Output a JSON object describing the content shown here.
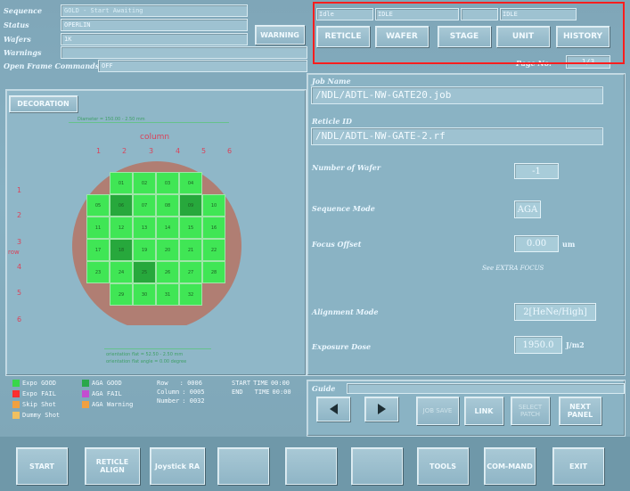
{
  "top_info": {
    "fields": [
      {
        "label": "Sequence",
        "value": "GOLD - Start Awaiting"
      },
      {
        "label": "Status",
        "value": "OPERLIN"
      },
      {
        "label": "Wafers",
        "value": "1K"
      },
      {
        "label": "Warnings",
        "value": ""
      },
      {
        "label": "Open Frame Commands",
        "value": "OFF"
      }
    ],
    "warning_button": "WARNING"
  },
  "top_right": {
    "small_labels": [
      "Idle",
      "IDLE",
      "IDLE"
    ],
    "buttons": [
      "RETICLE",
      "WAFER",
      "STAGE",
      "UNIT",
      "HISTORY"
    ],
    "page_no_label": "Page No.",
    "page_no_value": "1/3"
  },
  "wafer_panel": {
    "decoration_button": "DECORATION",
    "diameter_text": "Diameter = 150.00 - 2.50 mm",
    "column_title": "column",
    "column_labels": [
      "1",
      "2",
      "3",
      "4",
      "5",
      "6"
    ],
    "row_labels": [
      "1",
      "2",
      "3",
      "4",
      "5",
      "6"
    ],
    "row_title": "row",
    "orientation_text_1": "orientation flat = 52.50 - 2.50 mm",
    "orientation_text_2": "orientation flat angle = 0.00 degree",
    "shots": [
      {
        "r": 0,
        "c": 1,
        "shade": "light",
        "id": "01"
      },
      {
        "r": 0,
        "c": 2,
        "shade": "light",
        "id": "02"
      },
      {
        "r": 0,
        "c": 3,
        "shade": "light",
        "id": "03"
      },
      {
        "r": 0,
        "c": 4,
        "shade": "light",
        "id": "04"
      },
      {
        "r": 1,
        "c": 0,
        "shade": "light",
        "id": "05"
      },
      {
        "r": 1,
        "c": 1,
        "shade": "dark",
        "id": "06"
      },
      {
        "r": 1,
        "c": 2,
        "shade": "light",
        "id": "07"
      },
      {
        "r": 1,
        "c": 3,
        "shade": "light",
        "id": "08"
      },
      {
        "r": 1,
        "c": 4,
        "shade": "dark",
        "id": "09"
      },
      {
        "r": 1,
        "c": 5,
        "shade": "light",
        "id": "10"
      },
      {
        "r": 2,
        "c": 0,
        "shade": "light",
        "id": "11"
      },
      {
        "r": 2,
        "c": 1,
        "shade": "light",
        "id": "12"
      },
      {
        "r": 2,
        "c": 2,
        "shade": "light",
        "id": "13"
      },
      {
        "r": 2,
        "c": 3,
        "shade": "light",
        "id": "14"
      },
      {
        "r": 2,
        "c": 4,
        "shade": "light",
        "id": "15"
      },
      {
        "r": 2,
        "c": 5,
        "shade": "light",
        "id": "16"
      },
      {
        "r": 3,
        "c": 0,
        "shade": "light",
        "id": "17"
      },
      {
        "r": 3,
        "c": 1,
        "shade": "dark",
        "id": "18"
      },
      {
        "r": 3,
        "c": 2,
        "shade": "light",
        "id": "19"
      },
      {
        "r": 3,
        "c": 3,
        "shade": "light",
        "id": "20"
      },
      {
        "r": 3,
        "c": 4,
        "shade": "light",
        "id": "21"
      },
      {
        "r": 3,
        "c": 5,
        "shade": "light",
        "id": "22"
      },
      {
        "r": 4,
        "c": 0,
        "shade": "light",
        "id": "23"
      },
      {
        "r": 4,
        "c": 1,
        "shade": "light",
        "id": "24"
      },
      {
        "r": 4,
        "c": 2,
        "shade": "dark",
        "id": "25"
      },
      {
        "r": 4,
        "c": 3,
        "shade": "light",
        "id": "26"
      },
      {
        "r": 4,
        "c": 4,
        "shade": "light",
        "id": "27"
      },
      {
        "r": 4,
        "c": 5,
        "shade": "light",
        "id": "28"
      },
      {
        "r": 5,
        "c": 1,
        "shade": "light",
        "id": "29"
      },
      {
        "r": 5,
        "c": 2,
        "shade": "light",
        "id": "30"
      },
      {
        "r": 5,
        "c": 3,
        "shade": "light",
        "id": "31"
      },
      {
        "r": 5,
        "c": 4,
        "shade": "light",
        "id": "32"
      }
    ]
  },
  "legend": {
    "items": [
      {
        "label": "Expo GOOD",
        "color": "#39d74a"
      },
      {
        "label": "Expo FAIL",
        "color": "#ff2f2f"
      },
      {
        "label": "Skip Shot",
        "color": "#f0a040"
      },
      {
        "label": "Dummy Shot",
        "color": "#f0c060"
      },
      {
        "label": "AGA GOOD",
        "color": "#2aa84b"
      },
      {
        "label": "AGA FAIL",
        "color": "#c34cd0"
      },
      {
        "label": "AGA Warning",
        "color": "#f0a040"
      }
    ],
    "row_label": "Row",
    "row_value": ": 0006",
    "column_label": "Column",
    "column_value": ": 0005",
    "number_label": "Number",
    "number_value": ": 0032",
    "start_label": "START",
    "end_label": "END",
    "time_label": "TIME",
    "start_time": "00:00",
    "end_time": "00:00"
  },
  "job": {
    "job_name_label": "Job Name",
    "job_name_value": "/NDL/ADTL-NW-GATE20.job",
    "reticle_id_label": "Reticle ID",
    "reticle_id_value": "/NDL/ADTL-NW-GATE-2.rf",
    "params": [
      {
        "label": "Number of Wafer",
        "value": "-1",
        "unit": ""
      },
      {
        "label": "Sequence Mode",
        "value": "AGA",
        "unit": ""
      },
      {
        "label": "Focus Offset",
        "value": "0.00",
        "unit": "um"
      },
      {
        "label": "Alignment Mode",
        "value": "2[HeNe/High]",
        "unit": ""
      },
      {
        "label": "Exposure Dose",
        "value": "1950.0",
        "unit": "J/m2"
      }
    ],
    "extra_focus_note": "See EXTRA FOCUS"
  },
  "guide": {
    "label": "Guide",
    "value": "",
    "nav_buttons": {
      "left_icon": "left-arrow-icon",
      "right_icon": "right-arrow-icon",
      "job_save": "JOB SAVE",
      "link": "LINK",
      "select_patch": "SELECT PATCH",
      "next_panel": "NEXT PANEL"
    }
  },
  "bottom_bar": {
    "buttons": [
      "START",
      "RETICLE ALIGN",
      "Joystick RA",
      "",
      "",
      "",
      "TOOLS",
      "COM-MAND",
      "EXIT"
    ]
  },
  "highlight": {
    "color": "#ff1e1e"
  }
}
